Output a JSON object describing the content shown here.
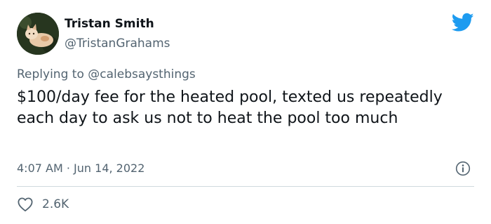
{
  "author": {
    "name": "Tristan Smith",
    "handle": "@TristanGrahams"
  },
  "reply": {
    "prefix": "Replying to",
    "mention": "@calebsaysthings"
  },
  "tweet": {
    "text": "$100/day fee for the heated pool, texted us repeatedly each day to ask us not to heat the pool too much",
    "time": "4:07 AM",
    "separator": "·",
    "date": "Jun 14, 2022"
  },
  "actions": {
    "like_count": "2.6K"
  },
  "icons": {
    "brand": "twitter-bird-icon",
    "info": "info-icon",
    "like": "heart-icon"
  },
  "colors": {
    "brand": "#1d9bf0",
    "text": "#0f1419",
    "secondary": "#536471",
    "divider": "#cfd9de"
  }
}
